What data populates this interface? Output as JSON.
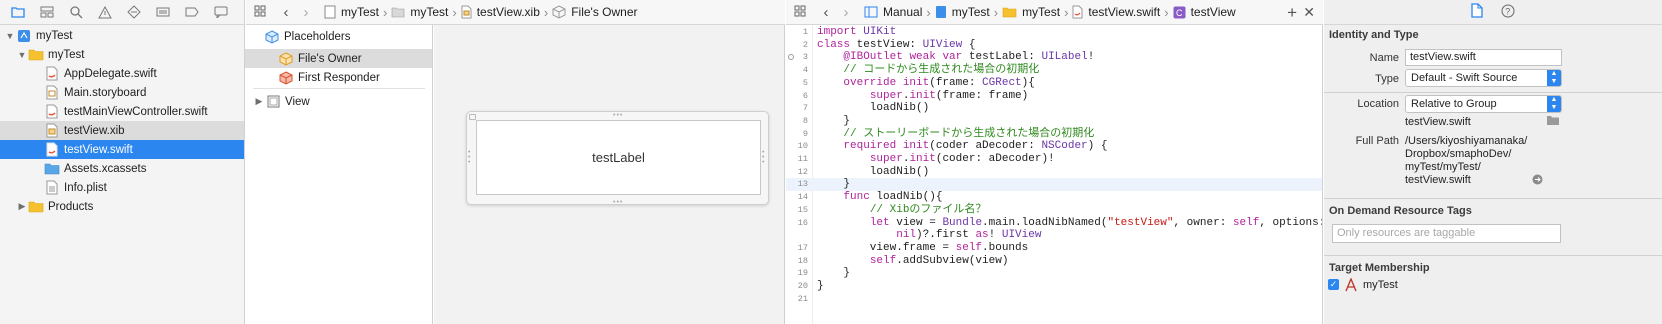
{
  "navigator": {
    "toolbar_icons": [
      "folder-icon",
      "source-control-icon",
      "find-icon",
      "warning-icon",
      "test-icon",
      "debug-icon",
      "breakpoint-icon",
      "report-icon"
    ],
    "items": [
      {
        "label": "myTest",
        "kind": "project"
      },
      {
        "label": "myTest",
        "kind": "folder"
      },
      {
        "label": "AppDelegate.swift",
        "kind": "swift"
      },
      {
        "label": "Main.storyboard",
        "kind": "storyboard"
      },
      {
        "label": "testMainViewController.swift",
        "kind": "swift"
      },
      {
        "label": "testView.xib",
        "kind": "xib"
      },
      {
        "label": "testView.swift",
        "kind": "swift"
      },
      {
        "label": "Assets.xcassets",
        "kind": "assets"
      },
      {
        "label": "Info.plist",
        "kind": "plist"
      },
      {
        "label": "Products",
        "kind": "folder"
      }
    ]
  },
  "left_jumpbar": {
    "crumbs": [
      "myTest",
      "myTest",
      "testView.xib",
      "File's Owner"
    ]
  },
  "outline": {
    "placeholders_label": "Placeholders",
    "files_owner": "File's Owner",
    "first_responder": "First Responder",
    "view_label": "View"
  },
  "canvas": {
    "label_text": "testLabel"
  },
  "right_jumpbar": {
    "crumbs": [
      "Manual",
      "myTest",
      "myTest",
      "testView.swift",
      "testView"
    ]
  },
  "editor": {
    "lines": [
      {
        "n": "1",
        "code": "import UIKit"
      },
      {
        "n": "2",
        "code": "class testView: UIView {"
      },
      {
        "n": "3",
        "code": "    @IBOutlet weak var testLabel: UILabel!"
      },
      {
        "n": "4",
        "code": "    // コードから生成された場合の初期化"
      },
      {
        "n": "5",
        "code": "    override init(frame: CGRect){"
      },
      {
        "n": "6",
        "code": "        super.init(frame: frame)"
      },
      {
        "n": "7",
        "code": "        loadNib()"
      },
      {
        "n": "8",
        "code": "    }"
      },
      {
        "n": "9",
        "code": "    // ストーリーボードから生成された場合の初期化"
      },
      {
        "n": "10",
        "code": "    required init(coder aDecoder: NSCoder) {"
      },
      {
        "n": "11",
        "code": "        super.init(coder: aDecoder)!"
      },
      {
        "n": "12",
        "code": "        loadNib()"
      },
      {
        "n": "13",
        "code": "    }"
      },
      {
        "n": "14",
        "code": "    func loadNib(){"
      },
      {
        "n": "15",
        "code": "        // Xibのファイル名？"
      },
      {
        "n": "16",
        "code": "        let view = Bundle.main.loadNibNamed(\"testView\", owner: self, options:"
      },
      {
        "n": "",
        "code": "            nil)?.first as! UIView"
      },
      {
        "n": "17",
        "code": "        view.frame = self.bounds"
      },
      {
        "n": "18",
        "code": "        self.addSubview(view)"
      },
      {
        "n": "19",
        "code": "    }"
      },
      {
        "n": "20",
        "code": "}"
      },
      {
        "n": "21",
        "code": ""
      }
    ]
  },
  "inspector": {
    "identity_title": "Identity and Type",
    "name_label": "Name",
    "name_value": "testView.swift",
    "type_label": "Type",
    "type_value": "Default - Swift Source",
    "location_label": "Location",
    "location_value": "Relative to Group",
    "location_file": "testView.swift",
    "fullpath_label": "Full Path",
    "fullpath_lines": [
      "/Users/kiyoshiyamanaka/",
      "Dropbox/smaphoDev/",
      "myTest/myTest/",
      "testView.swift"
    ],
    "odr_title": "On Demand Resource Tags",
    "odr_placeholder": "Only resources are taggable",
    "target_title": "Target Membership",
    "target_name": "myTest"
  },
  "colors": {
    "selection": "#2b86f0",
    "keyword": "#b0249c",
    "comment": "#2f8a1f",
    "string": "#c41a16",
    "type": "#6b36a8"
  }
}
